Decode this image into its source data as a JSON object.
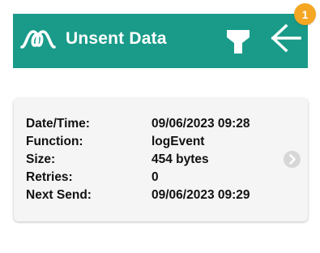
{
  "header": {
    "title": "Unsent Data",
    "background_color": "#1a9b8a",
    "logo_icon": "wave-loop-icon",
    "filter_icon": "filter-icon",
    "back_icon": "arrow-left-icon"
  },
  "badge": {
    "count": "1",
    "color": "#f5a623"
  },
  "record": {
    "rows": [
      {
        "label": "Date/Time:",
        "value": "09/06/2023 09:28"
      },
      {
        "label": "Function:",
        "value": "logEvent"
      },
      {
        "label": "Size:",
        "value": "454 bytes"
      },
      {
        "label": "Retries:",
        "value": "0"
      },
      {
        "label": "Next Send:",
        "value": "09/06/2023 09:29"
      }
    ],
    "chevron_icon": "chevron-right-icon"
  }
}
